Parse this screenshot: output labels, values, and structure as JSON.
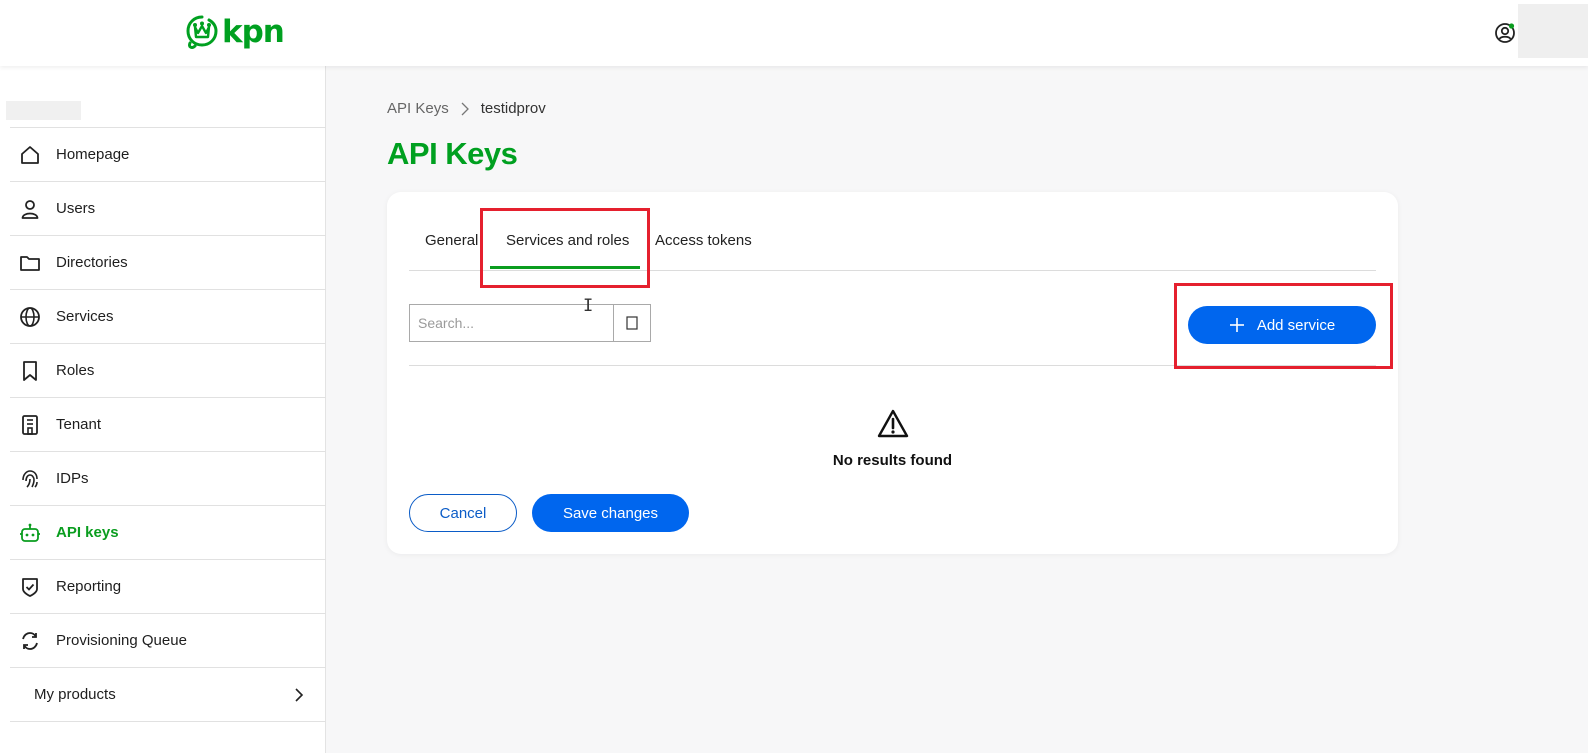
{
  "header": {
    "logo_text": "kpn",
    "brand_color": "#00a020",
    "profile_icon": "user-circle-icon"
  },
  "sidebar": {
    "items": [
      {
        "label": "Homepage",
        "icon": "home-icon"
      },
      {
        "label": "Users",
        "icon": "user-icon"
      },
      {
        "label": "Directories",
        "icon": "folder-icon"
      },
      {
        "label": "Services",
        "icon": "globe-icon"
      },
      {
        "label": "Roles",
        "icon": "bookmark-icon"
      },
      {
        "label": "Tenant",
        "icon": "building-icon"
      },
      {
        "label": "IDPs",
        "icon": "fingerprint-icon"
      },
      {
        "label": "API keys",
        "icon": "robot-icon",
        "active": true
      },
      {
        "label": "Reporting",
        "icon": "shield-check-icon"
      },
      {
        "label": "Provisioning Queue",
        "icon": "refresh-icon"
      }
    ],
    "products_label": "My products",
    "active_color": "#0a9d1f"
  },
  "breadcrumb": {
    "parent": "API Keys",
    "current": "testidprov"
  },
  "page": {
    "title": "API Keys"
  },
  "tabs": [
    {
      "label": "General"
    },
    {
      "label": "Services and roles",
      "active": true
    },
    {
      "label": "Access tokens"
    }
  ],
  "search": {
    "placeholder": "Search...",
    "value": ""
  },
  "add_service_label": "Add service",
  "empty_state": {
    "icon": "warning-icon",
    "text": "No results found"
  },
  "actions": {
    "cancel_label": "Cancel",
    "save_label": "Save changes",
    "primary_color": "#0066ee"
  },
  "highlight_color": "#e5202e"
}
